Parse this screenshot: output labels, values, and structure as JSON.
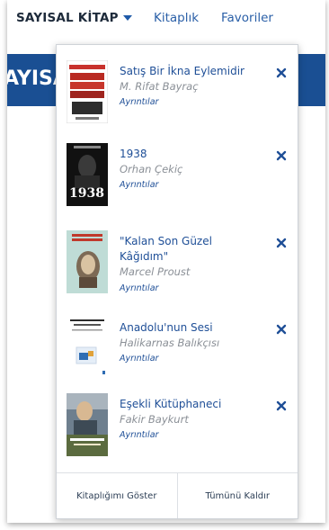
{
  "nav": {
    "brand": "SAYISAL KİTAP",
    "links": [
      "Kitaplık",
      "Favoriler"
    ]
  },
  "banner": {
    "text": "AYISA"
  },
  "colors": {
    "accent": "#1f4f97",
    "banner": "#1a4f93",
    "text": "#1d2a3a",
    "muted": "#8a8f96"
  },
  "dropdown": {
    "books": [
      {
        "title": "Satış Bir İkna Eylemidir",
        "author": "M. Rifat Bayraç",
        "details": "Ayrıntılar",
        "cover_icon": "book-cover-red"
      },
      {
        "title": "1938",
        "author": "Orhan Çekiç",
        "details": "Ayrıntılar",
        "cover_icon": "book-cover-dark",
        "cover_text": "1938"
      },
      {
        "title": "\"Kalan Son Güzel Kâğıdım\"",
        "author": "Marcel Proust",
        "details": "Ayrıntılar",
        "cover_icon": "book-cover-portrait"
      },
      {
        "title": "Anadolu'nun Sesi",
        "author": "Halikarnas Balıkçısı",
        "details": "Ayrıntılar",
        "cover_icon": "book-cover-white"
      },
      {
        "title": "Eşekli Kütüphaneci",
        "author": "Fakir Baykurt",
        "details": "Ayrıntılar",
        "cover_icon": "book-cover-photo"
      }
    ],
    "footer": {
      "show_library": "Kitaplığımı Göster",
      "remove_all": "Tümünü Kaldır"
    }
  }
}
